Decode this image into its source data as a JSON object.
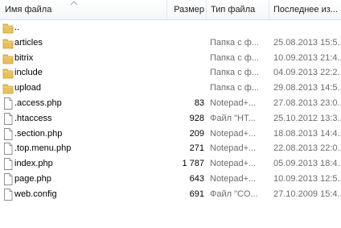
{
  "header": {
    "name": "Имя файла",
    "size": "Размер",
    "type": "Тип файла",
    "date": "Последнее из..."
  },
  "rows": [
    {
      "icon": "folder-icon",
      "name": "..",
      "size": "",
      "type": "",
      "date": ""
    },
    {
      "icon": "folder-icon",
      "name": "articles",
      "size": "",
      "type": "Папка с ф...",
      "date": "25.08.2013 15:5..."
    },
    {
      "icon": "folder-icon",
      "name": "bitrix",
      "size": "",
      "type": "Папка с ф...",
      "date": "10.09.2013 21:4..."
    },
    {
      "icon": "folder-icon",
      "name": "include",
      "size": "",
      "type": "Папка с ф...",
      "date": "04.09.2013 22:2..."
    },
    {
      "icon": "folder-icon",
      "name": "upload",
      "size": "",
      "type": "Папка с ф...",
      "date": "29.08.2013 14:5..."
    },
    {
      "icon": "file-icon",
      "name": ".access.php",
      "size": "83",
      "type": "Notepad+...",
      "date": "27.08.2013 23:0..."
    },
    {
      "icon": "file-icon",
      "name": ".htaccess",
      "size": "928",
      "type": "Файл \"HT...",
      "date": "25.10.2012 13:3..."
    },
    {
      "icon": "file-icon",
      "name": ".section.php",
      "size": "209",
      "type": "Notepad+...",
      "date": "18.08.2013 14:4..."
    },
    {
      "icon": "file-icon",
      "name": ".top.menu.php",
      "size": "271",
      "type": "Notepad+...",
      "date": "22.08.2013 22:0..."
    },
    {
      "icon": "file-icon",
      "name": "index.php",
      "size": "1 787",
      "type": "Notepad+...",
      "date": "05.09.2013 18:4..."
    },
    {
      "icon": "file-icon",
      "name": "page.php",
      "size": "643",
      "type": "Notepad+...",
      "date": "10.09.2013 12:5..."
    },
    {
      "icon": "file-icon",
      "name": "web.config",
      "size": "691",
      "type": "Файл \"CO...",
      "date": "27.10.2009 15:4..."
    }
  ],
  "colors": {
    "folder": "#e8c15a",
    "folder_dark": "#c99a2e",
    "header_border": "#d5dfe5",
    "meta_text": "#6d6d6d"
  }
}
